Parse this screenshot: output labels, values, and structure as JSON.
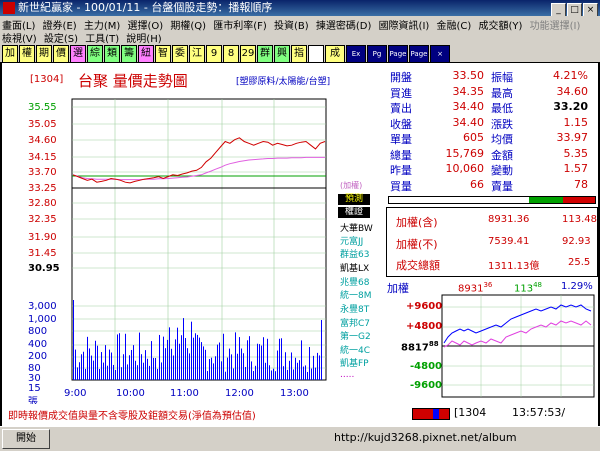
{
  "window": {
    "title": "新世紀贏家 - 100/01/11 - 台盤個股走勢：播報順序",
    "buttons": [
      "_",
      "□",
      "×"
    ]
  },
  "menu": {
    "row1": [
      "畫面(L)",
      "證券(E)",
      "主力(M)",
      "選擇(O)",
      "期權(Q)",
      "匯市利率(F)",
      "投資(B)",
      "揀選密碼(D)",
      "國際資訊(I)",
      "金融(C)",
      "成交額(Y)"
    ],
    "row1_grey": [
      "功能選擇(I)"
    ],
    "row2": [
      "檢視(V)",
      "設定(S)",
      "工具(T)",
      "說明(H)"
    ]
  },
  "toolbar": [
    "加",
    "權",
    "期",
    "價",
    "選",
    "綜",
    "類",
    "籌",
    "紐",
    "智",
    "委",
    "江",
    "9",
    "8",
    "29",
    "群",
    "興",
    "指",
    "",
    "成",
    "Ex",
    "Pg",
    "Page",
    "Page",
    "×"
  ],
  "header": {
    "code": "[1304]",
    "name": "台聚  量價走勢圖",
    "category": "[塑膠原料/太陽能/台塑]"
  },
  "price_axis": [
    "35.55",
    "35.05",
    "34.60",
    "34.15",
    "33.70",
    "33.25",
    "32.80",
    "32.35",
    "31.90",
    "31.45",
    "30.95"
  ],
  "volume_axis": [
    "3,000",
    "1,000",
    "800",
    "400",
    "200",
    "80",
    "30",
    "15",
    "張"
  ],
  "time_axis": [
    "9:00",
    "10:00",
    "11:00",
    "12:00",
    "13:00"
  ],
  "add_weight_label": "(加權)",
  "brokers": {
    "tabs": [
      "預測",
      "權證"
    ],
    "items": [
      "大華BW",
      "元富JJ",
      "群益63",
      "凱基LX",
      "兆豐68",
      "統一8M",
      "永豐8T",
      "富邦C7",
      "第一G2",
      "統一4C",
      "凱基FP",
      "....."
    ]
  },
  "quote": {
    "rows": [
      {
        "l1": "開盤",
        "v1": "33.50",
        "l2": "振幅",
        "v2": "4.21%"
      },
      {
        "l1": "買進",
        "v1": "34.35",
        "l2": "最高",
        "v2": "34.60"
      },
      {
        "l1": "賣出",
        "v1": "34.40",
        "l2": "最低",
        "v2": "33.20"
      },
      {
        "l1": "收盤",
        "v1": "34.40",
        "l2": "漲跌",
        "v2": "1.15"
      },
      {
        "l1": "單量",
        "v1": "605",
        "l2": "均價",
        "v2": "33.97"
      },
      {
        "l1": "總量",
        "v1": "15,769",
        "l2": "金額",
        "v2": "5.35"
      },
      {
        "l1": "昨量",
        "v1": "10,060",
        "l2": "變動",
        "v2": "1.57"
      },
      {
        "l1": "買量",
        "v1": "66",
        "l2": "賣量",
        "v2": "78"
      }
    ]
  },
  "index": {
    "rows": [
      {
        "label": "加權(含)",
        "value": "8931.36",
        "change": "113.48"
      },
      {
        "label": "加權(不)",
        "value": "7539.41",
        "change": "92.93"
      },
      {
        "label": "成交總額",
        "value": "1311.13億",
        "change": "25.5"
      }
    ],
    "mini": {
      "label": "加權",
      "value": "8931",
      "value_sup": "36",
      "change": "113",
      "change_sup": "48",
      "pct": "1.29%",
      "axis": [
        "+9600",
        "+4800",
        "8817",
        "-4800",
        "-9600"
      ],
      "axis_sup": "88"
    }
  },
  "status": {
    "note": "即時報價成交值與量不含零股及鉅額交易(淨值為預估值)",
    "code": "[1304",
    "time": "13:57:53/"
  },
  "taskbar": {
    "start": "開始",
    "url": "http://kujd3268.pixnet.net/album"
  }
}
